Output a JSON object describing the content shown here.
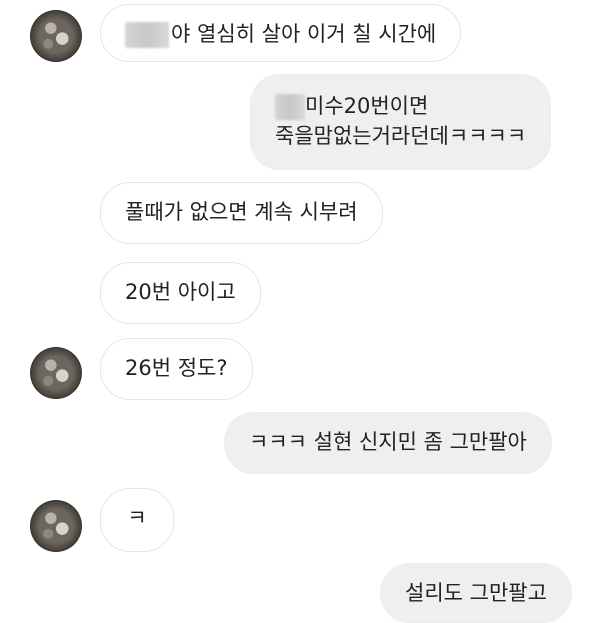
{
  "messages": [
    {
      "side": "incoming",
      "text": "야 열심히 살아 이거 칠 시간에",
      "redacted_prefix": true
    },
    {
      "side": "outgoing",
      "lines": [
        "미수20번이면",
        "죽을맘없는거라던데ㅋㅋㅋㅋ"
      ],
      "redacted_prefix": true
    },
    {
      "side": "incoming",
      "text": "풀때가 없으면 계속 시부려"
    },
    {
      "side": "incoming",
      "text": "20번 아이고"
    },
    {
      "side": "incoming",
      "text": "26번 정도?"
    },
    {
      "side": "outgoing",
      "text": "ㅋㅋㅋ 설현 신지민 좀 그만팔아"
    },
    {
      "side": "incoming",
      "text": "ㅋ"
    },
    {
      "side": "outgoing",
      "text": "설리도 그만팔고"
    }
  ]
}
